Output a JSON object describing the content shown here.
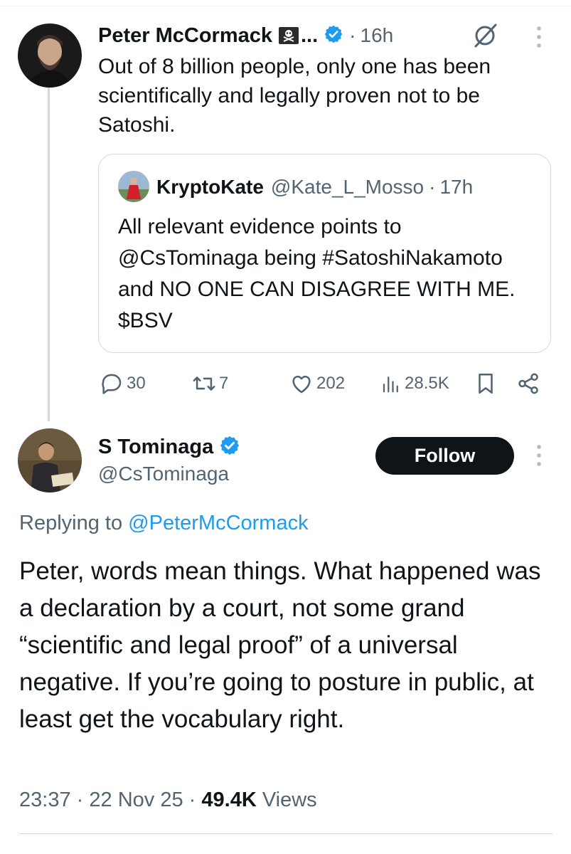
{
  "tweet1": {
    "author_name": "Peter McCormack",
    "name_suffix": "...",
    "separator": "·",
    "time": "16h",
    "text": "Out of 8 billion people, only one has been scientifically and legally proven not to be Satoshi.",
    "quote": {
      "author_name": "KryptoKate",
      "handle": "@Kate_L_Mosso",
      "separator": "·",
      "time": "17h",
      "text": "All relevant evidence points to @CsTominaga being #SatoshiNakamoto and NO ONE CAN DISAGREE WITH ME. $BSV"
    },
    "stats": {
      "replies": "30",
      "reposts": "7",
      "likes": "202",
      "views": "28.5K"
    }
  },
  "tweet2": {
    "author_name": "S Tominaga",
    "handle": "@CsTominaga",
    "follow_label": "Follow",
    "replying_prefix": "Replying to",
    "replying_to": "@PeterMcCormack",
    "text": "Peter, words mean things. What happened was a declaration by a court, not some grand “scientific and legal proof” of a universal negative. If you’re going to posture in public, at least get the vocabulary right.",
    "time": "23:37",
    "separator1": "·",
    "date": "22 Nov 25",
    "separator2": "·",
    "views_count": "49.4K",
    "views_label": "Views"
  },
  "colors": {
    "verified_blue": "#1d9bf0",
    "text_primary": "#0f1419",
    "text_secondary": "#536471",
    "follow_button_bg": "#0f1419",
    "thread_line": "#cfd9de"
  }
}
